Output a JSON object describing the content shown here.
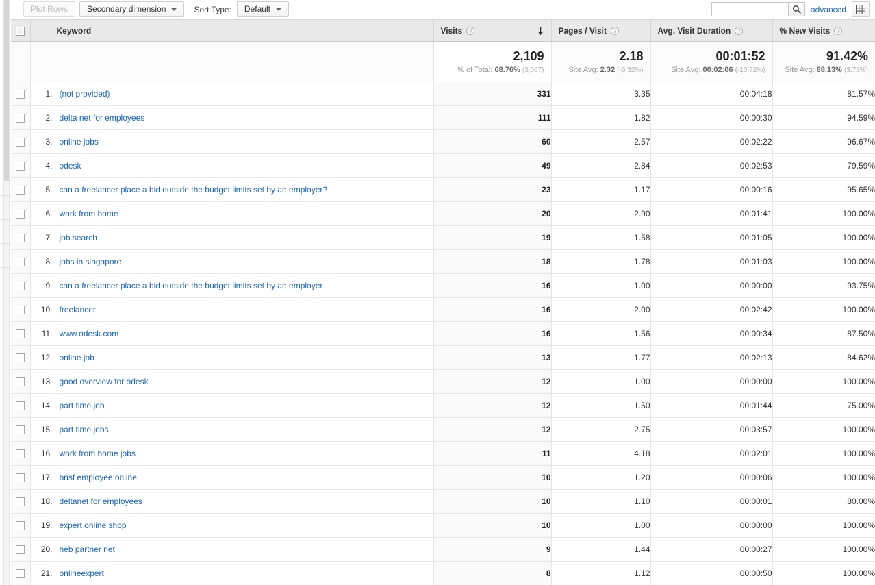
{
  "toolbar": {
    "plot_rows_label": "Plot Rows",
    "secondary_dimension_label": "Secondary dimension",
    "sort_type_label": "Sort Type:",
    "sort_type_value": "Default",
    "search_value": "",
    "search_placeholder": "",
    "advanced_label": "advanced",
    "search_icon": "search-icon",
    "grid_view_icon": "table-grid-icon"
  },
  "table": {
    "columns": [
      {
        "key": "keyword",
        "label": "Keyword",
        "help": "?",
        "sorted": false
      },
      {
        "key": "visits",
        "label": "Visits",
        "help": "?",
        "sorted": true,
        "sort_dir": "desc"
      },
      {
        "key": "pages_visit",
        "label": "Pages / Visit",
        "help": "?",
        "sorted": false
      },
      {
        "key": "avg_duration",
        "label": "Avg. Visit Duration",
        "help": "?",
        "sorted": false
      },
      {
        "key": "pct_new",
        "label": "% New Visits",
        "help": "?",
        "sorted": false
      }
    ],
    "summary": {
      "visits": {
        "value": "2,109",
        "sub_prefix": "% of Total:",
        "sub_value": "68.76%",
        "sub_paren": "(3,067)"
      },
      "pages_visit": {
        "value": "2.18",
        "sub_prefix": "Site Avg:",
        "sub_value": "2.32",
        "sub_paren": "(-6.32%)"
      },
      "avg_duration": {
        "value": "00:01:52",
        "sub_prefix": "Site Avg:",
        "sub_value": "00:02:06",
        "sub_paren": "(-10.72%)"
      },
      "pct_new": {
        "value": "91.42%",
        "sub_prefix": "Site Avg:",
        "sub_value": "88.13%",
        "sub_paren": "(3.73%)"
      }
    },
    "rows": [
      {
        "index": "1.",
        "keyword": "(not provided)",
        "visits": "331",
        "pages_visit": "3.35",
        "avg_duration": "00:04:18",
        "pct_new": "81.57%"
      },
      {
        "index": "2.",
        "keyword": "delta net for employees",
        "visits": "111",
        "pages_visit": "1.82",
        "avg_duration": "00:00:30",
        "pct_new": "94.59%"
      },
      {
        "index": "3.",
        "keyword": "online jobs",
        "visits": "60",
        "pages_visit": "2.57",
        "avg_duration": "00:02:22",
        "pct_new": "96.67%"
      },
      {
        "index": "4.",
        "keyword": "odesk",
        "visits": "49",
        "pages_visit": "2.84",
        "avg_duration": "00:02:53",
        "pct_new": "79.59%"
      },
      {
        "index": "5.",
        "keyword": "can a freelancer place a bid outside the budget limits set by an employer?",
        "visits": "23",
        "pages_visit": "1.17",
        "avg_duration": "00:00:16",
        "pct_new": "95.65%"
      },
      {
        "index": "6.",
        "keyword": "work from home",
        "visits": "20",
        "pages_visit": "2.90",
        "avg_duration": "00:01:41",
        "pct_new": "100.00%"
      },
      {
        "index": "7.",
        "keyword": "job search",
        "visits": "19",
        "pages_visit": "1.58",
        "avg_duration": "00:01:05",
        "pct_new": "100.00%"
      },
      {
        "index": "8.",
        "keyword": "jobs in singapore",
        "visits": "18",
        "pages_visit": "1.78",
        "avg_duration": "00:01:03",
        "pct_new": "100.00%"
      },
      {
        "index": "9.",
        "keyword": "can a freelancer place a bid outside the budget limits set by an employer",
        "visits": "16",
        "pages_visit": "1.00",
        "avg_duration": "00:00:00",
        "pct_new": "93.75%"
      },
      {
        "index": "10.",
        "keyword": "freelancer",
        "visits": "16",
        "pages_visit": "2.00",
        "avg_duration": "00:02:42",
        "pct_new": "100.00%"
      },
      {
        "index": "11.",
        "keyword": "www.odesk.com",
        "visits": "16",
        "pages_visit": "1.56",
        "avg_duration": "00:00:34",
        "pct_new": "87.50%"
      },
      {
        "index": "12.",
        "keyword": "online job",
        "visits": "13",
        "pages_visit": "1.77",
        "avg_duration": "00:02:13",
        "pct_new": "84.62%"
      },
      {
        "index": "13.",
        "keyword": "good overview for odesk",
        "visits": "12",
        "pages_visit": "1.00",
        "avg_duration": "00:00:00",
        "pct_new": "100.00%"
      },
      {
        "index": "14.",
        "keyword": "part time job",
        "visits": "12",
        "pages_visit": "1.50",
        "avg_duration": "00:01:44",
        "pct_new": "75.00%"
      },
      {
        "index": "15.",
        "keyword": "part time jobs",
        "visits": "12",
        "pages_visit": "2.75",
        "avg_duration": "00:03:57",
        "pct_new": "100.00%"
      },
      {
        "index": "16.",
        "keyword": "work from home jobs",
        "visits": "11",
        "pages_visit": "4.18",
        "avg_duration": "00:02:01",
        "pct_new": "100.00%"
      },
      {
        "index": "17.",
        "keyword": "bnsf employee online",
        "visits": "10",
        "pages_visit": "1.20",
        "avg_duration": "00:00:06",
        "pct_new": "100.00%"
      },
      {
        "index": "18.",
        "keyword": "deltanet for employees",
        "visits": "10",
        "pages_visit": "1.10",
        "avg_duration": "00:00:01",
        "pct_new": "80.00%"
      },
      {
        "index": "19.",
        "keyword": "expert online shop",
        "visits": "10",
        "pages_visit": "1.00",
        "avg_duration": "00:00:00",
        "pct_new": "100.00%"
      },
      {
        "index": "20.",
        "keyword": "heb partner net",
        "visits": "9",
        "pages_visit": "1.44",
        "avg_duration": "00:00:27",
        "pct_new": "100.00%"
      },
      {
        "index": "21.",
        "keyword": "onlineexpert",
        "visits": "8",
        "pages_visit": "1.12",
        "avg_duration": "00:00:50",
        "pct_new": "100.00%"
      }
    ]
  },
  "colors": {
    "link": "#1b65b6",
    "header_bg": "#e9e9e9",
    "sorted_col_bg": "#fafafa",
    "border": "#e6e6e6"
  }
}
